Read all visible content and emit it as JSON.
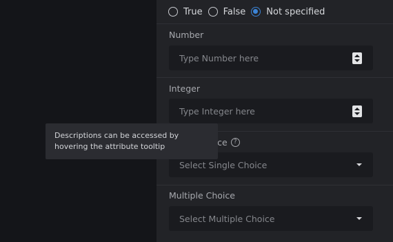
{
  "boolean_field": {
    "options": [
      {
        "label": "True",
        "checked": false
      },
      {
        "label": "False",
        "checked": false
      },
      {
        "label": "Not specified",
        "checked": true
      }
    ]
  },
  "number_field": {
    "label": "Number",
    "placeholder": "Type Number here"
  },
  "integer_field": {
    "label": "Integer",
    "placeholder": "Type Integer here"
  },
  "single_choice_field": {
    "label": "Single Choice",
    "placeholder": "Select Single Choice"
  },
  "multiple_choice_field": {
    "label": "Multiple Choice",
    "placeholder": "Select Multiple Choice"
  },
  "tooltip": {
    "text": "Descriptions can be accessed by hovering the attribute tooltip"
  },
  "icons": {
    "help": "help-circle-icon",
    "stepper": "stepper-icon",
    "dropdown": "chevron-down-icon"
  },
  "colors": {
    "accent": "#3c84d6",
    "panel_bg": "#222327",
    "input_bg": "#1a1b1f"
  }
}
